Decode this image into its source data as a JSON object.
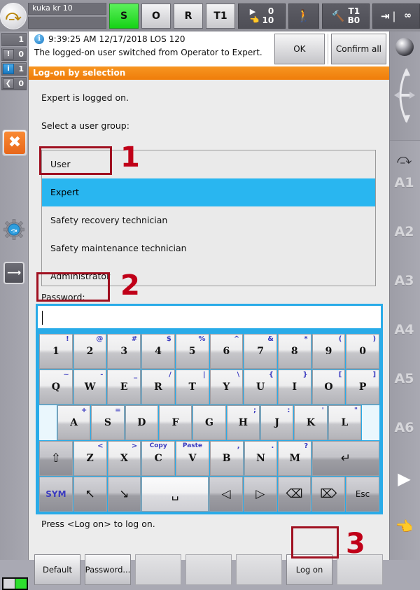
{
  "statusbar": {
    "robot_icon": "kuka-robot-logo-icon",
    "robot_name": "kuka kr 10",
    "program_name": "",
    "submit_label": "S",
    "drives_label": "O",
    "robot_interpreter_label": "R",
    "mode_label": "T1",
    "speed_program": "0",
    "speed_manual": "10",
    "run_icon": "play-icon",
    "hand_icon": "hand-icon",
    "walk_icon": "walking-person-icon",
    "tool_icon": "tool-base-icon",
    "tool_value": "T1",
    "base_value": "B0",
    "increment_icon": "increment-jog-icon",
    "increment_value": "∞"
  },
  "left_rail": {
    "counters": [
      {
        "icon": "blank-icon",
        "value": "1"
      },
      {
        "icon": "warning-icon",
        "value": "0"
      },
      {
        "icon": "info-icon",
        "value": "1"
      },
      {
        "icon": "ack-icon",
        "value": "0"
      }
    ],
    "stop_button": "stop-x-button",
    "gear_icon": "gear-robot-settings-icon",
    "clock_icon": "clock-timer-icon",
    "battery_icon": "battery-status-icon"
  },
  "right_rail": {
    "globe_icon": "world-coordinate-globe-icon",
    "arc_icon": "jog-direction-arc-icon",
    "axis_icon": "robot-axis-icon",
    "axes": [
      "A1",
      "A2",
      "A3",
      "A4",
      "A5",
      "A6"
    ],
    "play_icon": "play-forward-icon",
    "hand_icon": "jog-hand-icon"
  },
  "message": {
    "icon": "info-message-icon",
    "timestamp": "9:39:25 AM 12/17/2018 LOS 120",
    "text": "The logged-on user switched from Operator to Expert.",
    "ok_label": "OK",
    "confirm_all_label": "Confirm all"
  },
  "panel": {
    "title": "Log-on by selection",
    "status_text": "Expert is logged on.",
    "prompt_text": "Select a user group:",
    "user_groups": [
      {
        "label": "User",
        "selected": false
      },
      {
        "label": "Expert",
        "selected": true
      },
      {
        "label": "Safety recovery technician",
        "selected": false
      },
      {
        "label": "Safety maintenance technician",
        "selected": false
      },
      {
        "label": "Administrator",
        "selected": false
      }
    ],
    "password_label": "Password:",
    "password_value": "",
    "hint_text": "Press <Log on> to log on."
  },
  "keyboard": {
    "rows": [
      [
        {
          "main": "1",
          "alt": "!",
          "style": "key"
        },
        {
          "main": "2",
          "alt": "@",
          "style": "key"
        },
        {
          "main": "3",
          "alt": "#",
          "style": "key"
        },
        {
          "main": "4",
          "alt": "$",
          "style": "key"
        },
        {
          "main": "5",
          "alt": "%",
          "style": "key"
        },
        {
          "main": "6",
          "alt": "^",
          "style": "key"
        },
        {
          "main": "7",
          "alt": "&",
          "style": "key"
        },
        {
          "main": "8",
          "alt": "*",
          "style": "key"
        },
        {
          "main": "9",
          "alt": "(",
          "style": "key"
        },
        {
          "main": "0",
          "alt": ")",
          "style": "key"
        }
      ],
      [
        {
          "main": "Q",
          "alt": "~",
          "style": "key"
        },
        {
          "main": "W",
          "alt": "-",
          "style": "key"
        },
        {
          "main": "E",
          "alt": "_",
          "style": "key"
        },
        {
          "main": "R",
          "alt": "/",
          "style": "key"
        },
        {
          "main": "T",
          "alt": "|",
          "style": "key"
        },
        {
          "main": "Y",
          "alt": "\\",
          "style": "key"
        },
        {
          "main": "U",
          "alt": "{",
          "style": "key"
        },
        {
          "main": "I",
          "alt": "}",
          "style": "key"
        },
        {
          "main": "O",
          "alt": "[",
          "style": "key"
        },
        {
          "main": "P",
          "alt": "]",
          "style": "key"
        }
      ],
      [
        {
          "main": "",
          "alt": "",
          "style": "spacer"
        },
        {
          "main": "A",
          "alt": "+",
          "style": "key"
        },
        {
          "main": "S",
          "alt": "=",
          "style": "key"
        },
        {
          "main": "D",
          "alt": "",
          "style": "key"
        },
        {
          "main": "F",
          "alt": "",
          "style": "key"
        },
        {
          "main": "G",
          "alt": "",
          "style": "key"
        },
        {
          "main": "H",
          "alt": ";",
          "style": "key"
        },
        {
          "main": "J",
          "alt": ":",
          "style": "key"
        },
        {
          "main": "K",
          "alt": "'",
          "style": "key"
        },
        {
          "main": "L",
          "alt": "\"",
          "style": "key"
        },
        {
          "main": "",
          "alt": "",
          "style": "spacer"
        }
      ],
      [
        {
          "main": "⇧",
          "alt": "",
          "style": "dark",
          "name": "shift-key"
        },
        {
          "main": "Z",
          "alt": "<",
          "style": "key"
        },
        {
          "main": "X",
          "alt": ">",
          "style": "key"
        },
        {
          "main": "C",
          "alt": "Copy",
          "style": "key",
          "altword": true
        },
        {
          "main": "V",
          "alt": "Paste",
          "style": "key",
          "altword": true
        },
        {
          "main": "B",
          "alt": ",",
          "style": "key"
        },
        {
          "main": "N",
          "alt": ".",
          "style": "key"
        },
        {
          "main": "M",
          "alt": "?",
          "style": "key"
        },
        {
          "main": "↵",
          "alt": "",
          "style": "dark",
          "name": "enter-key"
        }
      ],
      [
        {
          "main": "SYM",
          "alt": "",
          "style": "sym",
          "name": "sym-key"
        },
        {
          "main": "↖",
          "alt": "",
          "style": "dark",
          "name": "home-key"
        },
        {
          "main": "↘",
          "alt": "",
          "style": "dark",
          "name": "end-key"
        },
        {
          "main": "␣",
          "alt": "",
          "style": "light",
          "name": "space-key"
        },
        {
          "main": "◁",
          "alt": "",
          "style": "dark",
          "name": "cursor-left-key"
        },
        {
          "main": "▷",
          "alt": "",
          "style": "dark",
          "name": "cursor-right-key"
        },
        {
          "main": "⌫",
          "alt": "",
          "style": "dark",
          "name": "backspace-key"
        },
        {
          "main": "⌦",
          "alt": "",
          "style": "dark",
          "name": "delete-key"
        },
        {
          "main": "Esc",
          "alt": "",
          "style": "dark",
          "name": "escape-key"
        }
      ]
    ]
  },
  "function_buttons": [
    {
      "label": "Default",
      "name": "default-button",
      "empty": false
    },
    {
      "label": "Password...",
      "name": "password-button",
      "empty": false
    },
    {
      "label": "",
      "name": "softkey-3",
      "empty": true
    },
    {
      "label": "",
      "name": "softkey-4",
      "empty": true
    },
    {
      "label": "",
      "name": "softkey-5",
      "empty": true
    },
    {
      "label": "Log on",
      "name": "log-on-button",
      "empty": false
    },
    {
      "label": "",
      "name": "softkey-7",
      "empty": true
    }
  ],
  "annotations": [
    {
      "number": "1",
      "target": "expert-user-group-row"
    },
    {
      "number": "2",
      "target": "password-input"
    },
    {
      "number": "3",
      "target": "log-on-button"
    }
  ],
  "colors": {
    "accent_orange": "#ef7d0a",
    "selection_blue": "#29b6f0",
    "keyboard_border_blue": "#29abe8",
    "annotation_red": "#a01020",
    "status_green": "#16d216"
  }
}
